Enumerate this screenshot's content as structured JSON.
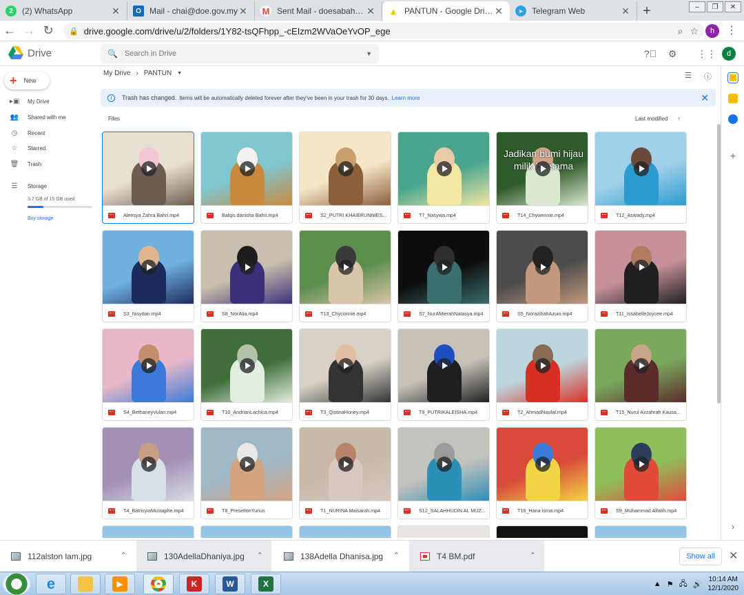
{
  "browser": {
    "tabs": [
      {
        "title": "(2) WhatsApp",
        "icon": "whatsapp-icon",
        "badge": "2",
        "color": "#25d366"
      },
      {
        "title": "Mail - chai@doe.gov.my",
        "icon": "outlook-icon",
        "badge": "O",
        "color": "#0f6cbd"
      },
      {
        "title": "Sent Mail - doesabah.event@",
        "icon": "gmail-icon",
        "badge": "M",
        "color": "#ea4335"
      },
      {
        "title": "PANTUN - Google Drive",
        "icon": "drive-icon",
        "badge": "▲",
        "color": "#fbbc04"
      },
      {
        "title": "Telegram Web",
        "icon": "telegram-icon",
        "badge": "➤",
        "color": "#2aa3df"
      }
    ],
    "url": "drive.google.com/drive/u/2/folders/1Y82-tsQFhpp_-cEIzm2WVaOeYvOP_ege",
    "profile_initial": "h"
  },
  "drive": {
    "app_name": "Drive",
    "search_placeholder": "Search in Drive",
    "account_initial": "d",
    "nav": {
      "new_label": "New",
      "items": [
        "My Drive",
        "Shared with me",
        "Recent",
        "Starred",
        "Trash",
        "Storage"
      ],
      "storage_used": "3.7 GB of 15 GB used",
      "storage_fraction": 0.247,
      "buy_storage": "Buy storage"
    },
    "breadcrumb": {
      "root": "My Drive",
      "current": "PANTUN"
    },
    "banner": {
      "title": "Trash has changed.",
      "body": "Items will be automatically deleted forever after they've been in your trash for 30 days.",
      "link": "Learn more"
    },
    "files_label": "Files",
    "sort_label": "Last modified",
    "files": [
      "Aleesya Zahra Bahri.mp4",
      "Balqis danisha Bahri.mp4",
      "S2_PUTRI KHAIERUNNIES...",
      "T7_Nasywa.mp4",
      "T14_Chywennie.mp4",
      "T12_Aswady.mp4",
      "S3_Nisydan.mp4",
      "S8_NorAlia.mp4",
      "T13_Chyconnie.mp4",
      "S7_NurAMierahNatasya.mp4",
      "S5_NorazihahAzuin.mp4",
      "T11_IssabelleJoycee.mp4",
      "S4_BethaneyVulan.mp4",
      "T10_AndrianLachica.mp4",
      "T3_QistinaHoney.mp4",
      "T9_PUTRIKALEISHA.mp4",
      "T2_AhmadNaufal.mp4",
      "T15_Nurul Azzahrah Kausa...",
      "T4_BatrisyiaMustaphe.mp4",
      "T8_PreseltonYunus",
      "T1_NURINA Maisarah.mp4",
      "S12_SALAHHUDIN AL MUZ...",
      "T16_Hana Isma.mp4",
      "S9_Muhammad Alfatih.mp4"
    ],
    "thumb_overlays": {
      "4": "Jadikan bumi hijau milik bersama"
    }
  },
  "downloads": {
    "items": [
      "112alston lam.jpg",
      "130AdellaDhaniya.jpg",
      "138Adella Dhanisa.jpg",
      "T4 BM.pdf"
    ],
    "show_all": "Show all"
  },
  "taskbar": {
    "time": "10:14 AM",
    "date": "12/1/2020"
  }
}
